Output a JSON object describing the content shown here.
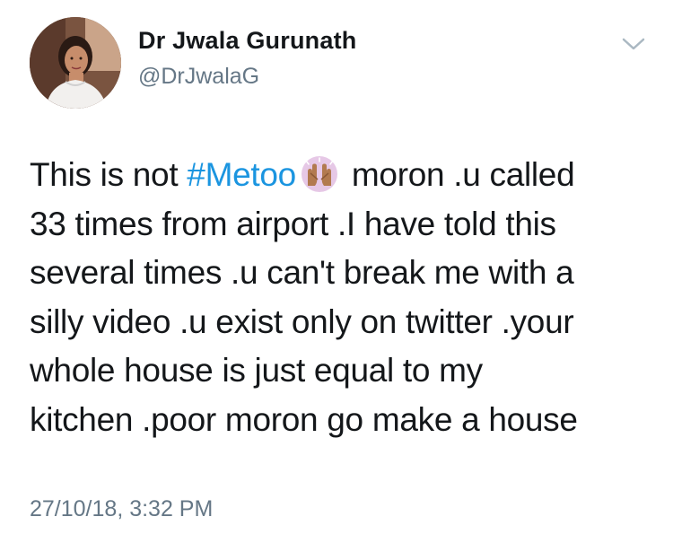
{
  "author": {
    "display_name": "Dr Jwala Gurunath",
    "handle": "@DrJwalaG"
  },
  "tweet": {
    "line1_before": "This is not ",
    "hashtag": "#Metoo",
    "emoji": "raised-hands-emoji",
    "line1_after": " moron .u called",
    "line2": "33 times from airport .I have told this",
    "line3": "several times .u can't break me with a",
    "line4": "silly video .u exist only on twitter .your",
    "line5": "whole house is just equal to my",
    "line6": "kitchen .poor moron go make a house"
  },
  "timestamp": "27/10/18, 3:32 PM",
  "icons": {
    "menu": "chevron-down-icon"
  },
  "colors": {
    "text": "#14171a",
    "secondary": "#657786",
    "link": "#1b95e0",
    "background": "#ffffff"
  }
}
